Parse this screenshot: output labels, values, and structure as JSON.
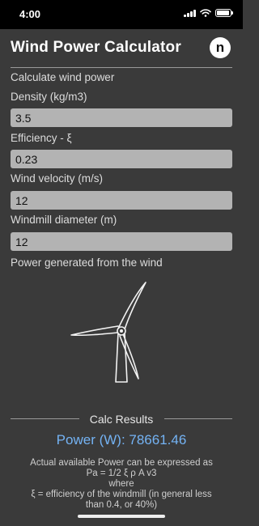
{
  "status_bar": {
    "time": "4:00",
    "icons": [
      "signal-icon",
      "wifi-icon",
      "battery-icon"
    ]
  },
  "header": {
    "title": "Wind Power Calculator",
    "logo_letter": "n"
  },
  "form": {
    "intro": "Calculate wind power",
    "density": {
      "label": "Density (kg/m3)",
      "value": "3.5"
    },
    "efficiency": {
      "label": "Efficiency - ξ",
      "value": "0.23"
    },
    "wind_velocity": {
      "label": "Wind velocity (m/s)",
      "value": "12"
    },
    "windmill_diameter": {
      "label": "Windmill diameter (m)",
      "value": "12"
    },
    "output_caption": "Power generated from the wind"
  },
  "illustration": {
    "icon": "wind-turbine-icon"
  },
  "results": {
    "heading": "Calc Results",
    "power_line": "Power (W): 78661.46",
    "explanation": [
      "Actual available Power can be expressed as",
      "Pa = 1/2 ξ ρ A v3",
      "where",
      "ξ = efficiency of the windmill (in general less",
      "than 0.4, or 40%)"
    ]
  },
  "colors": {
    "background": "#3a3a3a",
    "status_bar": "#000000",
    "field_background": "#b3b3b3",
    "result_accent": "#74b3f4"
  }
}
